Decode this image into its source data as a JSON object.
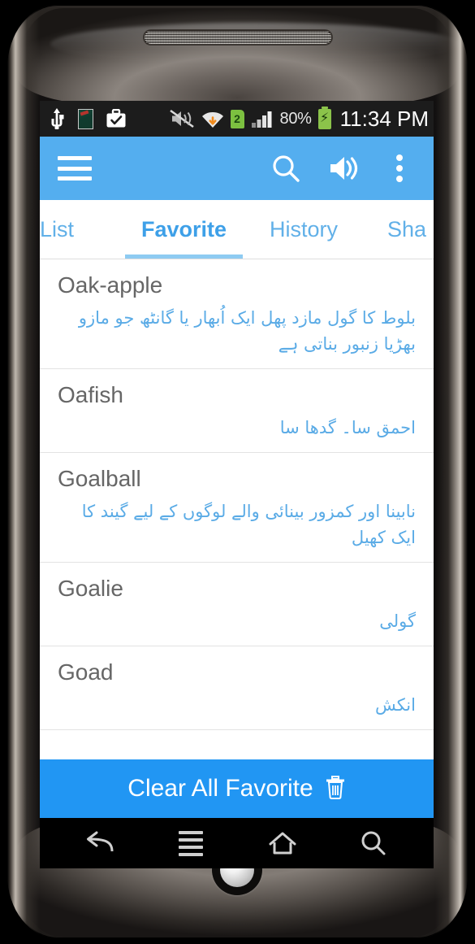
{
  "statusbar": {
    "icons": [
      "usb-icon",
      "screenshot-thumb-icon",
      "briefcase-check-icon",
      "mute-vibrate-off-icon",
      "wifi-download-icon"
    ],
    "sim_badge": "2",
    "battery_percent": "80%",
    "clock": "11:34 PM"
  },
  "appbar": {
    "menu_icon": "hamburger-menu-icon",
    "search_icon": "search-icon",
    "sound_icon": "volume-speaker-icon",
    "overflow_icon": "overflow-menu-icon",
    "accent_color": "#54aeef"
  },
  "tabs": [
    {
      "label": "List",
      "active": false
    },
    {
      "label": "Favorite",
      "active": true
    },
    {
      "label": "History",
      "active": false
    },
    {
      "label": "Sha",
      "active": false
    }
  ],
  "list": [
    {
      "word": "Oak-apple",
      "meaning": "بلوط کا گول مازد پھل   ایک اُبھار یا گانٹھ جو مازو بھڑیا زنبور بناتی ہے"
    },
    {
      "word": "Oafish",
      "meaning": "احمق سا۔ گدھا سا"
    },
    {
      "word": "Goalball",
      "meaning": "نابینا اور کمزور بینائی والے لوگوں کے لیے   گیند کا ایک کھیل"
    },
    {
      "word": "Goalie",
      "meaning": "گولی"
    },
    {
      "word": "Goad",
      "meaning": "انکش"
    }
  ],
  "clear_button": {
    "label": "Clear All Favorite",
    "icon": "trash-icon",
    "color": "#2196f3"
  },
  "navbar": {
    "back": "back-arrow-icon",
    "menu": "menu-lines-icon",
    "home": "home-icon",
    "search": "search-icon"
  }
}
